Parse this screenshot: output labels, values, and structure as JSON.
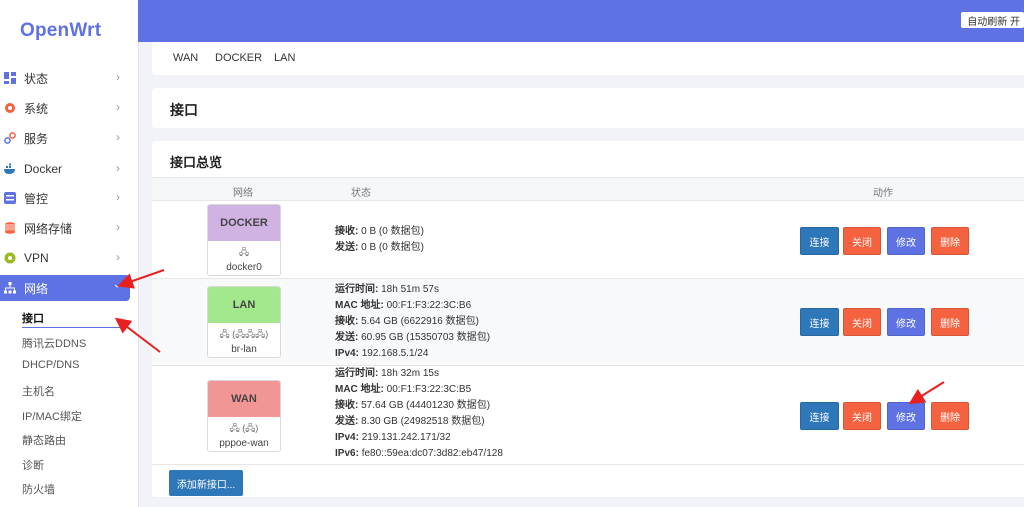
{
  "brand": {
    "name": "OpenWrt",
    "accent": "#5e72e4"
  },
  "topbar": {
    "refresh_label": "自动刷新 开"
  },
  "sidebar": {
    "items": [
      {
        "label": "状态",
        "icon": "dashboard-icon",
        "color": "#5e72e4"
      },
      {
        "label": "系统",
        "icon": "gear-icon",
        "color": "#f4623f"
      },
      {
        "label": "服务",
        "icon": "link-icon",
        "color": "#5e72e4"
      },
      {
        "label": "Docker",
        "icon": "docker-icon",
        "color": "#2e77b8"
      },
      {
        "label": "管控",
        "icon": "control-icon",
        "color": "#5e72e4"
      },
      {
        "label": "网络存储",
        "icon": "storage-icon",
        "color": "#f4623f"
      },
      {
        "label": "VPN",
        "icon": "vpn-icon",
        "color": "#9abb1e"
      },
      {
        "label": "网络",
        "icon": "network-icon",
        "color": "#ffffff"
      }
    ],
    "subitems": [
      "接口",
      "腾讯云DDNS",
      "DHCP/DNS",
      "主机名",
      "IP/MAC绑定",
      "静态路由",
      "诊断",
      "防火墙"
    ]
  },
  "tabs": [
    "WAN",
    "DOCKER",
    "LAN"
  ],
  "page_title": "接口",
  "overview": {
    "title": "接口总览",
    "headers": {
      "network": "网络",
      "status": "状态",
      "actions": "动作"
    }
  },
  "buttons": {
    "connect": "连接",
    "close": "关闭",
    "edit": "修改",
    "delete": "删除",
    "add": "添加新接口..."
  },
  "interfaces": [
    {
      "name": "DOCKER",
      "head_color": "#d1b3e3",
      "icons": "🖧",
      "device": "docker0",
      "status": [
        {
          "k": "接收:",
          "v": "0 B (0 数据包)"
        },
        {
          "k": "发送:",
          "v": "0 B (0 数据包)"
        }
      ]
    },
    {
      "name": "LAN",
      "head_color": "#a4e88e",
      "icons": "🖧 (🖧🖧🖧)",
      "device": "br-lan",
      "status": [
        {
          "k": "运行时间:",
          "v": "18h 51m 57s"
        },
        {
          "k": "MAC 地址:",
          "v": "00:F1:F3:22:3C:B6"
        },
        {
          "k": "接收:",
          "v": "5.64 GB (6622916 数据包)"
        },
        {
          "k": "发送:",
          "v": "60.95 GB (15350703 数据包)"
        },
        {
          "k": "IPv4:",
          "v": "192.168.5.1/24"
        }
      ]
    },
    {
      "name": "WAN",
      "head_color": "#f29595",
      "icons": "🖧 (🖧)",
      "device": "pppoe-wan",
      "status": [
        {
          "k": "运行时间:",
          "v": "18h 32m 15s"
        },
        {
          "k": "MAC 地址:",
          "v": "00:F1:F3:22:3C:B5"
        },
        {
          "k": "接收:",
          "v": "57.64 GB (44401230 数据包)"
        },
        {
          "k": "发送:",
          "v": "8.30 GB (24982518 数据包)"
        },
        {
          "k": "IPv4:",
          "v": "219.131.242.171/32"
        },
        {
          "k": "IPv6:",
          "v": "fe80::59ea:dc07:3d82:eb47/128"
        }
      ]
    }
  ]
}
